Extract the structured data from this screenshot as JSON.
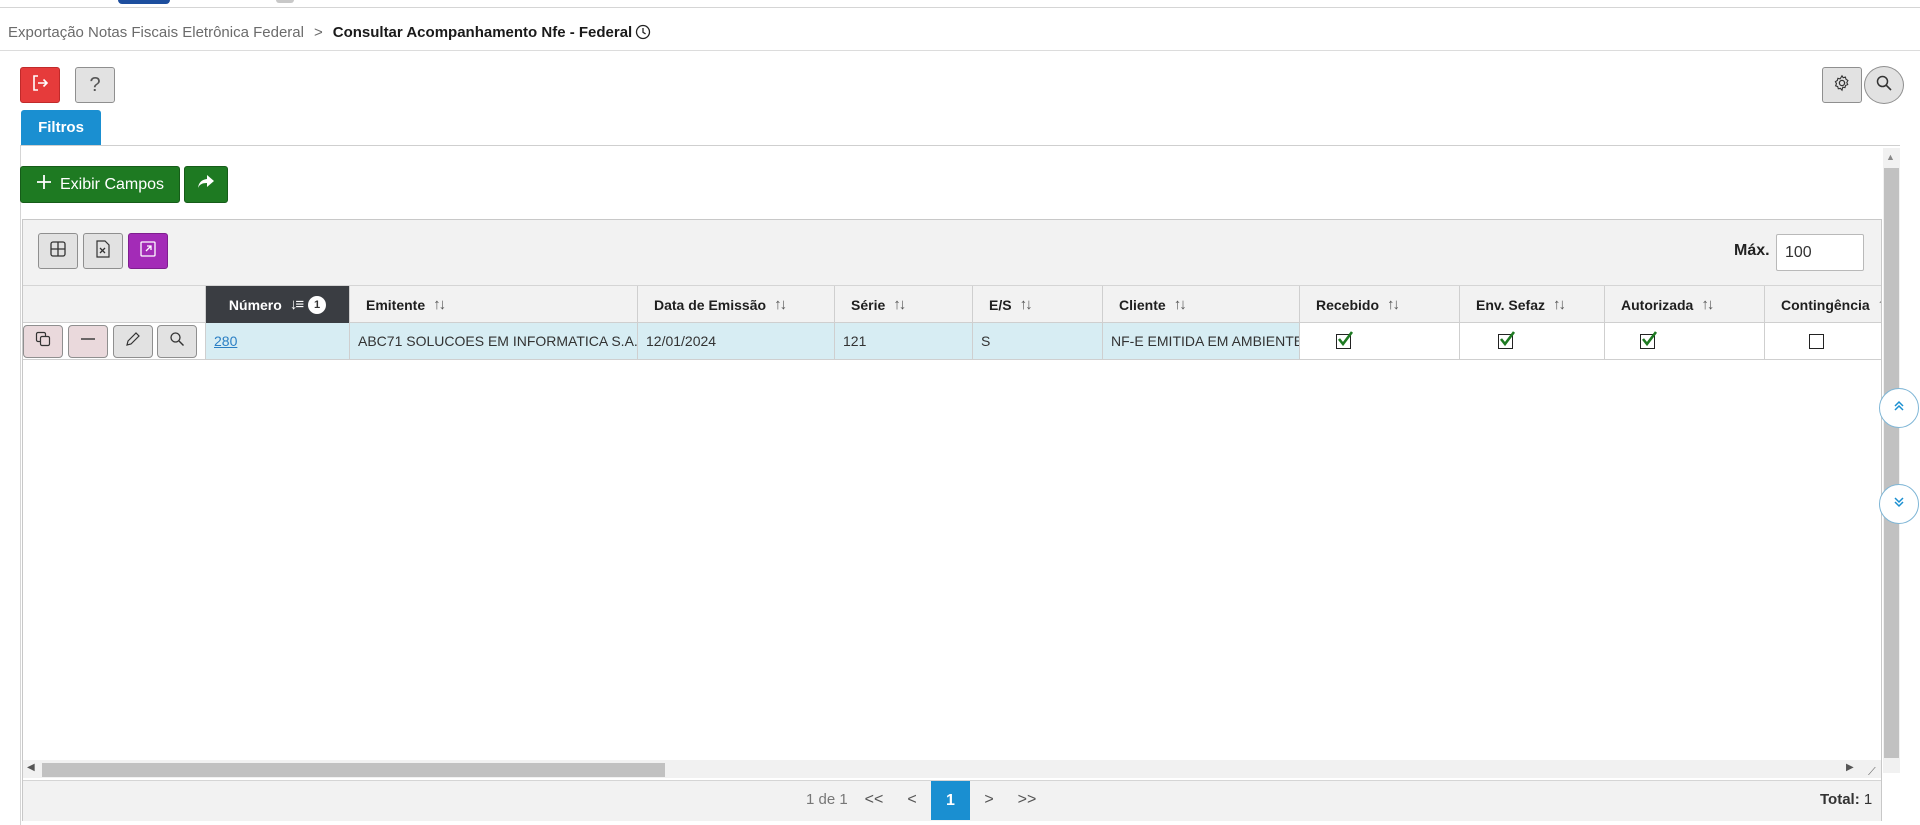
{
  "breadcrumb": {
    "parent": "Exportação Notas Fiscais Eletrônica Federal",
    "separator": ">",
    "current": "Consultar Acompanhamento Nfe - Federal"
  },
  "toolbar": {
    "exit_icon": "exit-icon",
    "help_label": "?",
    "settings_icon": "gear-icon",
    "search_icon": "search-icon"
  },
  "tabs": [
    {
      "label": "Filtros",
      "active": true
    }
  ],
  "actions": {
    "exibir_campos_label": "Exibir Campos",
    "share_icon": "share-icon"
  },
  "grid_toolbar": {
    "max_label": "Máx.",
    "max_value": "100"
  },
  "columns": [
    {
      "label": "Número",
      "sorted": true,
      "sort_order": "1"
    },
    {
      "label": "Emitente"
    },
    {
      "label": "Data de Emissão"
    },
    {
      "label": "Série"
    },
    {
      "label": "E/S"
    },
    {
      "label": "Cliente"
    },
    {
      "label": "Recebido"
    },
    {
      "label": "Env. Sefaz"
    },
    {
      "label": "Autorizada"
    },
    {
      "label": "Contingência"
    }
  ],
  "rows": [
    {
      "numero": "280",
      "emitente": "ABC71 SOLUCOES EM INFORMATICA S.A.",
      "data_emissao": "12/01/2024",
      "serie": "121",
      "es": "S",
      "cliente": "NF-E EMITIDA EM AMBIENTE...",
      "recebido": true,
      "env_sefaz": true,
      "autorizada": true,
      "contingencia": false
    }
  ],
  "pager": {
    "info": "1 de 1",
    "first": "<<",
    "prev": "<",
    "current": "1",
    "next": ">",
    "last": ">>",
    "total_label": "Total:",
    "total_value": "1"
  },
  "colors": {
    "primary": "#1a8fd1",
    "success": "#1e7a22",
    "danger": "#e63b3b",
    "purple": "#a32bb7",
    "row_highlight": "#d7edf3",
    "sorted_header": "#3a3d42"
  }
}
